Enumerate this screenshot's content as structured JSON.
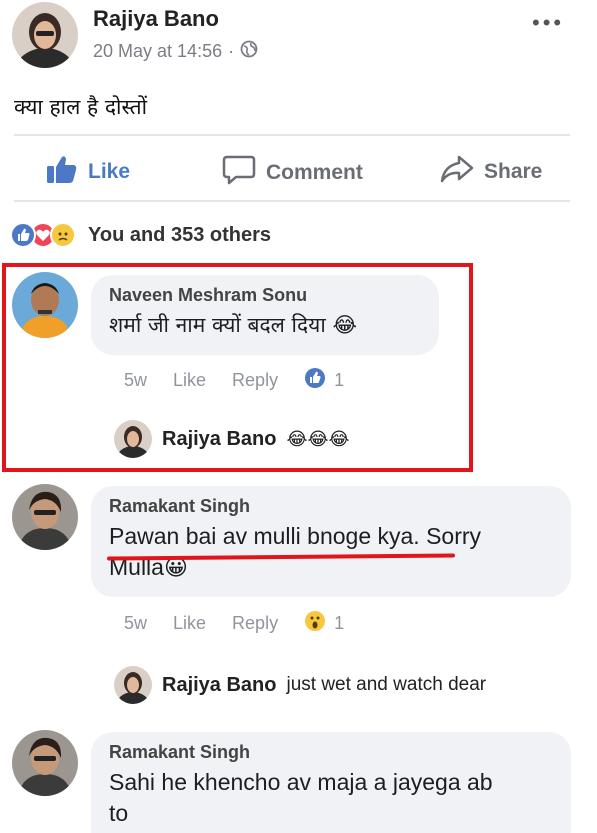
{
  "post": {
    "author": "Rajiya Bano",
    "timestamp": "20 May at 14:56",
    "separator": "·",
    "privacy_icon": "globe-icon",
    "text": "क्या हाल है दोस्तों",
    "more": "•••"
  },
  "actions": {
    "like": "Like",
    "comment": "Comment",
    "share": "Share"
  },
  "reactions": {
    "summary": "You and 353 others",
    "icons": [
      "like",
      "love",
      "sad"
    ]
  },
  "comments": [
    {
      "author": "Naveen Meshram Sonu",
      "text": "शर्मा जी नाम क्यों बदल दिया 😂",
      "age": "5w",
      "like": "Like",
      "reply": "Reply",
      "reaction_count": "1",
      "reply_author": "Rajiya Bano",
      "reply_text": "😂😂😂"
    },
    {
      "author": "Ramakant Singh",
      "text_line1": "Pawan bai av mulli bnoge kya. Sorry",
      "text_line2": "Mulla😀",
      "age": "5w",
      "like": "Like",
      "reply": "Reply",
      "reaction_count": "1",
      "reply_author": "Rajiya Bano",
      "reply_text": "just wet and watch dear"
    },
    {
      "author": "Ramakant Singh",
      "text_line1": "Sahi he khencho av maja a jayega ab",
      "text_line2": "to"
    }
  ],
  "colors": {
    "highlight": "#e0161c",
    "like_blue": "#4b79c5",
    "bubble_bg": "#f0f2f5"
  }
}
